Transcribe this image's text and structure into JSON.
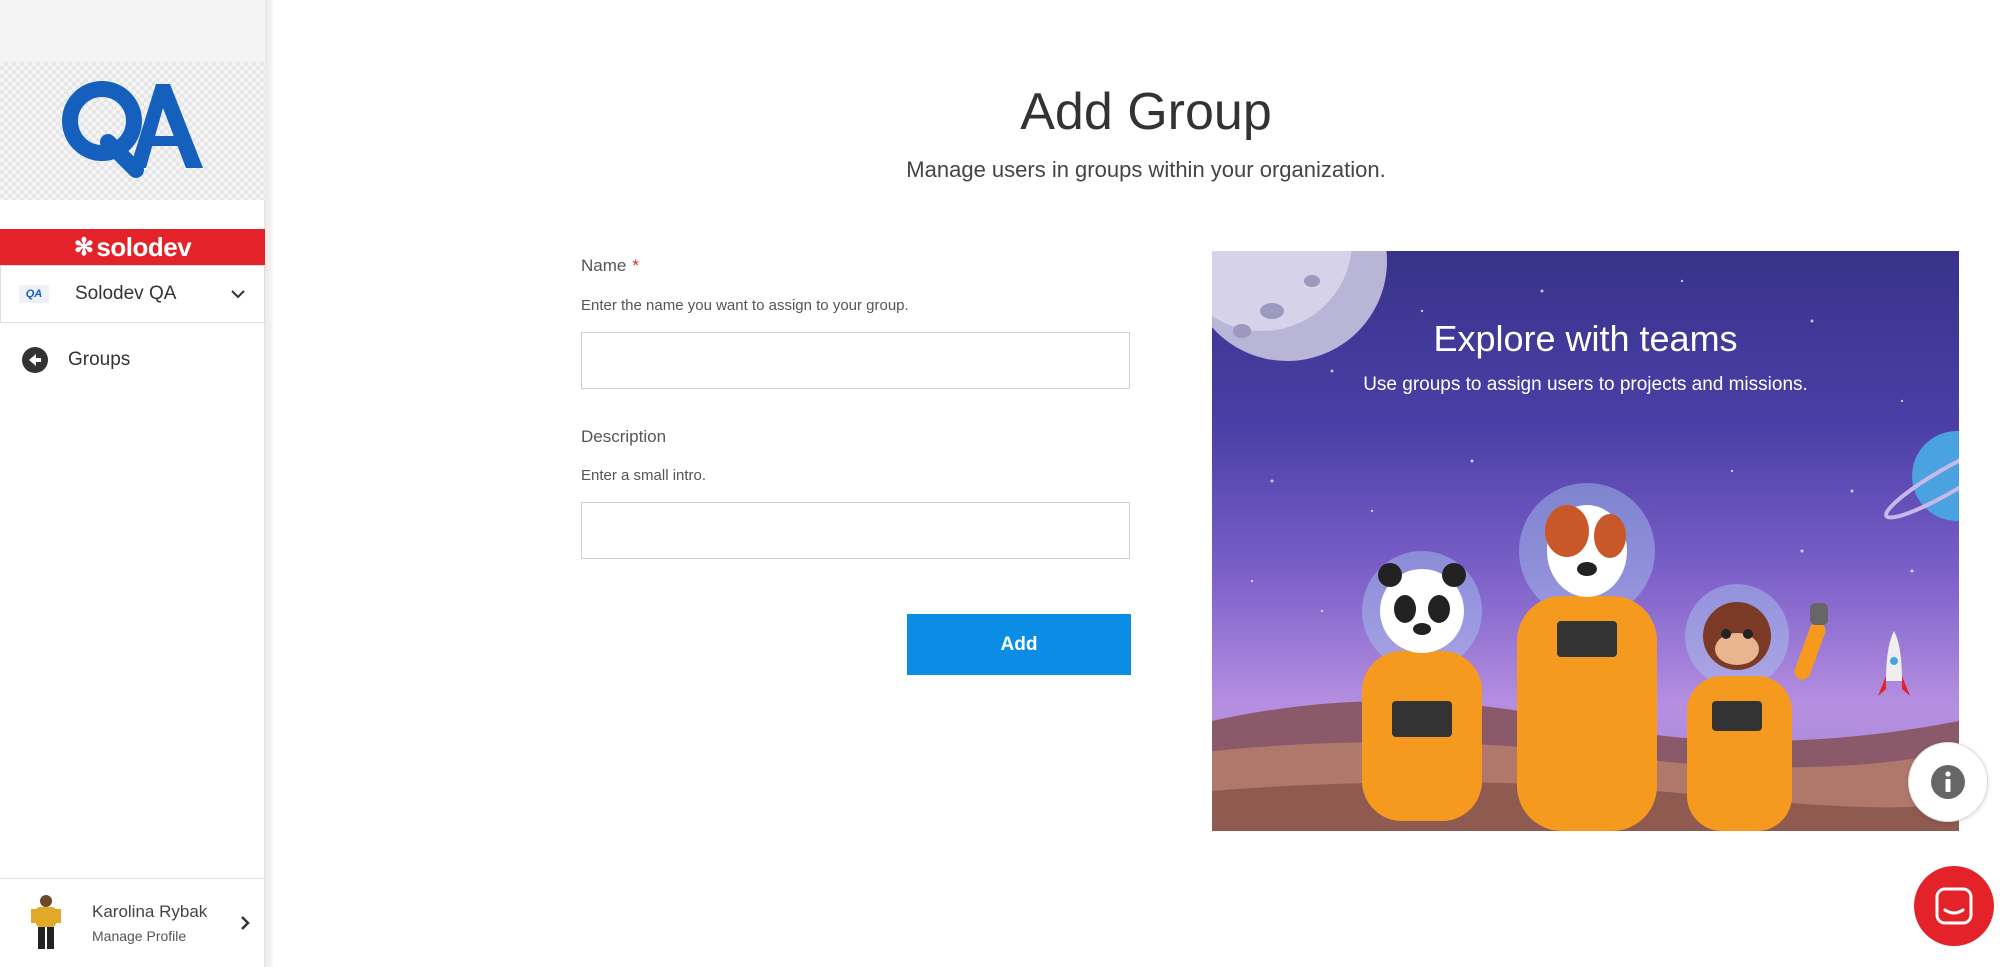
{
  "sidebar": {
    "logo_text": "QA",
    "brand_name": "solodev",
    "org": {
      "badge": "QA",
      "name": "Solodev QA"
    },
    "nav_back": {
      "label": "Groups"
    },
    "profile": {
      "name": "Karolina Rybak",
      "sub": "Manage Profile"
    }
  },
  "page": {
    "title": "Add Group",
    "subtitle": "Manage users in groups within your organization."
  },
  "form": {
    "name_label": "Name",
    "name_required": "*",
    "name_hint": "Enter the name you want to assign to your group.",
    "name_value": "",
    "description_label": "Description",
    "description_hint": "Enter a small intro.",
    "description_value": "",
    "submit_label": "Add"
  },
  "hero": {
    "title": "Explore with teams",
    "subtitle": "Use groups to assign users to projects and missions."
  },
  "colors": {
    "brand_red": "#e32229",
    "accent_blue": "#0b8de6",
    "logo_blue": "#1560bd"
  },
  "icons": [
    "chevron-down-icon",
    "back-arrow-icon",
    "chevron-right-icon",
    "info-icon",
    "chat-icon",
    "solodev-flower-icon"
  ]
}
